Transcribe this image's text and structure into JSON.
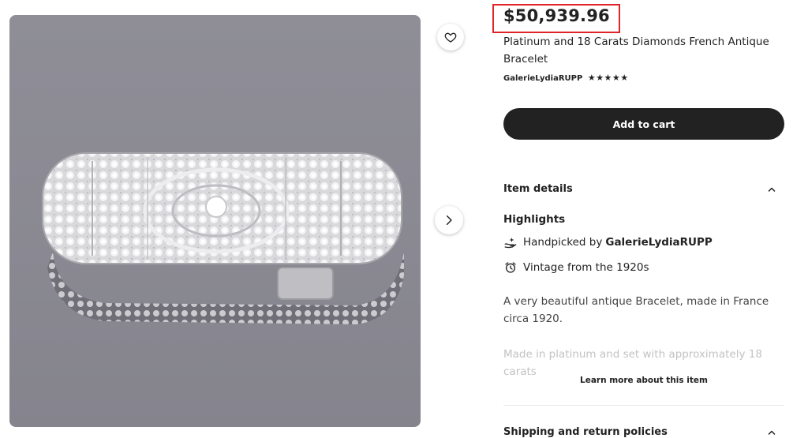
{
  "listing": {
    "price": "$50,939.96",
    "title": "Platinum and 18 Carats Diamonds French Antique Bracelet",
    "shop_name": "GalerieLydiaRUPP",
    "rating_stars": "★★★★★",
    "rating_value": 5,
    "add_to_cart_label": "Add to cart"
  },
  "item_details": {
    "header": "Item details",
    "highlights_label": "Highlights",
    "handpicked_prefix": "Handpicked by",
    "handpicked_shop": "GalerieLydiaRUPP",
    "vintage_text": "Vintage from the 1920s",
    "description": "A very beautiful antique Bracelet, made in France circa 1920.",
    "description_faded": "Made in platinum and set with approximately 18 carats",
    "learn_more_label": "Learn more about this item"
  },
  "shipping": {
    "header": "Shipping and return policies"
  },
  "icons": {
    "favorite": "heart-icon",
    "next": "chevron-right-icon",
    "collapse": "chevron-up-icon",
    "handpicked": "hand-sparkle-icon",
    "vintage": "alarm-clock-icon"
  },
  "colors": {
    "highlight_box": "#e0242b",
    "cart_button": "#222222"
  }
}
